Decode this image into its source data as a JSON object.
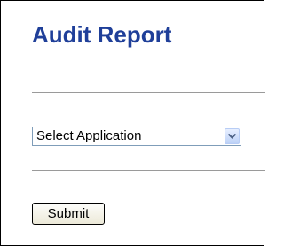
{
  "page": {
    "title": "Audit Report"
  },
  "form": {
    "application_select": {
      "selected_value": "Select Application"
    },
    "submit_label": "Submit"
  },
  "colors": {
    "title": "#1f3f99",
    "rule": "#9a9a9a",
    "select_border": "#7f9db9"
  },
  "icons": {
    "dropdown": "chevron-down-icon"
  }
}
